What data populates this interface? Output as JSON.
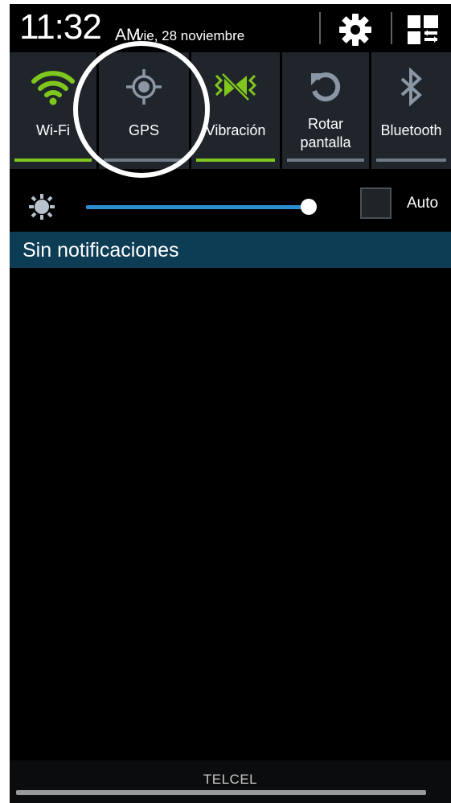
{
  "status_bar": {
    "time": "11:32",
    "ampm": "AM",
    "date": "vie, 28 noviembre",
    "settings_icon": "gear-icon",
    "multiwindow_icon": "multi-window-icon"
  },
  "toggles": [
    {
      "label": "Wi-Fi",
      "icon": "wifi-icon",
      "on": true
    },
    {
      "label": "GPS",
      "icon": "gps-icon",
      "on": false
    },
    {
      "label": "Vibración",
      "icon": "vibration-icon",
      "on": true
    },
    {
      "label": "Rotar pantalla",
      "label_line1": "Rotar",
      "label_line2": "pantalla",
      "icon": "rotate-icon",
      "on": false
    },
    {
      "label": "Bluetooth",
      "icon": "bluetooth-icon",
      "on": false
    }
  ],
  "brightness": {
    "level": 0.94,
    "auto_label": "Auto",
    "auto_checked": false
  },
  "notifications": {
    "header": "Sin notificaciones"
  },
  "carrier": {
    "label": "TELCEL"
  },
  "colors": {
    "toggle_on": "#7fc61f",
    "toggle_off": "#6f7a87",
    "brightness_track": "#2d8dd1",
    "notif_header_bg": "#0d3c55"
  }
}
